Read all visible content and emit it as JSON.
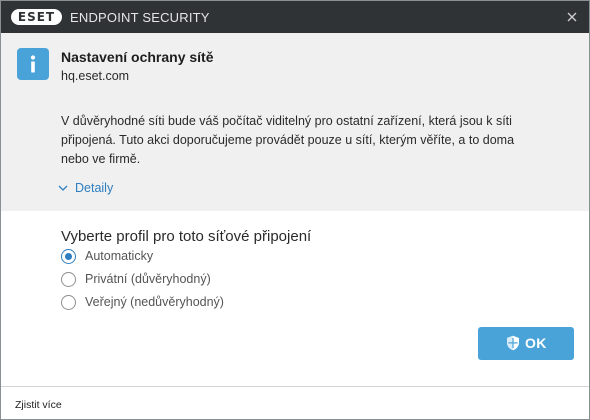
{
  "window": {
    "brand": "eset",
    "app_title": "ENDPOINT SECURITY",
    "close_icon": "close-icon"
  },
  "header": {
    "icon": "info-icon",
    "title": "Nastavení ochrany sítě",
    "subtitle": "hq.eset.com"
  },
  "description": "V důvěryhodné síti bude váš počítač viditelný pro ostatní zařízení, která jsou k síti připojená. Tuto akci doporučujeme provádět pouze u sítí, kterým věříte, a to doma nebo ve firmě.",
  "details": {
    "label": "Detaily",
    "icon": "chevron-down-icon"
  },
  "profile": {
    "heading": "Vyberte profil pro toto síťové připojení",
    "selected": "Automaticky",
    "options": [
      {
        "label": "Automaticky"
      },
      {
        "label": "Privátní (důvěryhodný)"
      },
      {
        "label": "Veřejný (nedůvěryhodný)"
      }
    ]
  },
  "ok_button": {
    "label": "OK",
    "icon": "shield-icon"
  },
  "footer": {
    "learn_more": "Zjistit více"
  },
  "colors": {
    "titlebar": "#2f3336",
    "accent": "#4aa3d8",
    "link": "#2d7ec0",
    "info_panel": "#f0f0f0"
  }
}
